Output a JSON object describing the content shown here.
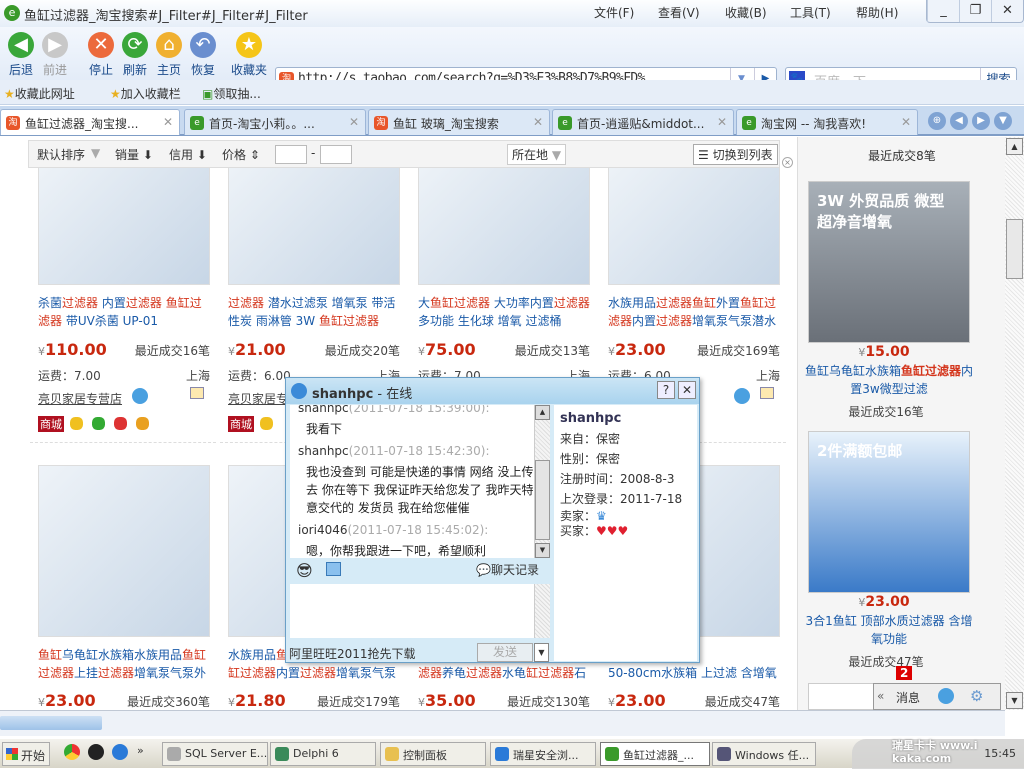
{
  "window": {
    "title": "鱼缸过滤器_淘宝搜索#J_Filter#J_Filter#J_Filter",
    "menu": [
      "文件(F)",
      "查看(V)",
      "收藏(B)",
      "工具(T)",
      "帮助(H)"
    ],
    "controls": [
      "_",
      "❐",
      "✕"
    ]
  },
  "toolbar": {
    "buttons": [
      {
        "label": "后退",
        "icon": "back-arrow-icon",
        "color": "#3aa73a",
        "glyph": "◀"
      },
      {
        "label": "前进",
        "icon": "forward-arrow-icon",
        "color": "#c8c8c8",
        "glyph": "▶"
      },
      {
        "label": "停止",
        "icon": "stop-icon",
        "color": "#ec6a3c",
        "glyph": "✕"
      },
      {
        "label": "刷新",
        "icon": "refresh-icon",
        "color": "#3aa73a",
        "glyph": "⟳"
      },
      {
        "label": "主页",
        "icon": "home-icon",
        "color": "#f0b030",
        "glyph": "⌂"
      },
      {
        "label": "恢复",
        "icon": "undo-icon",
        "color": "#6a8ecf",
        "glyph": "↶"
      },
      {
        "label": "收藏夹",
        "icon": "star-icon",
        "color": "#f5c518",
        "glyph": "★"
      }
    ],
    "url": "http://s.taobao.com/search?q=%D3%E3%B8%D7%B9%FD%",
    "search_placeholder": "百度一下",
    "search_button": "搜索"
  },
  "favbar": [
    "收藏此网址",
    "加入收藏栏",
    "领取抽..."
  ],
  "tabs": [
    {
      "label": "鱼缸过滤器_淘宝搜...",
      "active": true,
      "favicon": "淘"
    },
    {
      "label": "首页-淘宝小莉。。...",
      "favicon": "e"
    },
    {
      "label": "鱼缸 玻璃_淘宝搜索",
      "favicon": "淘"
    },
    {
      "label": "首页-逍遥贴&middot...",
      "favicon": "e"
    },
    {
      "label": "淘宝网 -- 淘我喜欢!",
      "favicon": "e"
    }
  ],
  "sortbar": {
    "default": "默认排序",
    "sales": "销量 ⬇",
    "credit": "信用 ⬇",
    "price": "价格 ⇕",
    "range_sep": "-",
    "location": "所在地",
    "switch": "☰ 切换到列表"
  },
  "products_row1": [
    {
      "title_html": "杀菌<em>过滤器</em> 内置<em>过滤器</em> <em>鱼缸过滤器</em> 带UV杀菌 UP-01",
      "price": "110.00",
      "sold": "最近成交16笔",
      "ship": "运费：7.00",
      "loc": "上海",
      "shop": "亮贝家居专营店"
    },
    {
      "title_html": "<em>过滤器</em> 潜水过滤泵 增氧泵 带活性炭 雨淋管 3W <em>鱼缸过滤器</em>",
      "price": "21.00",
      "sold": "最近成交20笔",
      "ship": "运费：6.00",
      "loc": "上海",
      "shop": "亮贝家居专"
    },
    {
      "title_html": "大<em>鱼缸过滤器</em> 大功率内置<em>过滤器</em> 多功能 生化球 增氧 过滤桶",
      "price": "75.00",
      "sold": "最近成交13笔",
      "ship": "运费：7.00",
      "loc": "上海",
      "shop": ""
    },
    {
      "title_html": "水族用品<em>过滤器鱼缸</em>外置<em>鱼缸过滤器</em>内置<em>过滤器</em>增氧泵气泵潜水",
      "price": "23.00",
      "sold": "最近成交169笔",
      "ship": "运费：6.00",
      "loc": "上海",
      "shop": "店"
    }
  ],
  "products_row2": [
    {
      "title_html": "<em>鱼缸</em>乌龟缸水族箱水族用品<em>鱼缸过滤器</em>上挂<em>过滤器</em>增氧泵气泵外",
      "price": "23.00",
      "sold": "最近成交360笔"
    },
    {
      "title_html": "水族用品<em>鱼</em><br><em>缸过滤器</em>内置<em>过滤器</em>增氧泵气泵",
      "price": "21.80",
      "sold": "最近成交179笔"
    },
    {
      "title_html": "<br><em>滤器</em>养龟<em>过滤器</em>水龟<em>缸过滤器</em>石",
      "price": "35.00",
      "sold": "最近成交130笔"
    },
    {
      "title_html": "<em>缸过滤器</em> 适用<br>50-80cm水族箱 上过滤 含增氧",
      "price": "23.00",
      "sold": "最近成交47笔"
    }
  ],
  "currency": "¥",
  "badges": {
    "mall": "商城"
  },
  "side": {
    "top_sold": "最近成交8笔",
    "items": [
      {
        "price": "15.00",
        "title_html": "鱼缸乌龟缸水族箱<b style=\"color:#d4351c\">鱼缸过滤器</b>内置3w微型过滤",
        "sold": "最近成交16笔",
        "img_text": "3W 外贸品质 微型 超净音增氧"
      },
      {
        "price": "23.00",
        "title_html": "3合1鱼缸 顶部水质过滤器 含增氧功能",
        "sold": "最近成交47笔",
        "img_text": "2件满额包邮"
      }
    ]
  },
  "wangwang_bar": {
    "count": "2",
    "label": "消息",
    "collapse": "«"
  },
  "chat": {
    "title_user": "shanhpc",
    "title_status": " - 在线",
    "help": "?",
    "close": "✕",
    "messages": [
      {
        "who": "shanhpc",
        "time": "(2011-07-18 15:39:00):",
        "text": "我看下"
      },
      {
        "who": "shanhpc",
        "time": "(2011-07-18 15:42:30):",
        "text": "我也没查到 可能是快递的事情 网络 没上传去 你在等下 我保证昨天给您发了 我昨天特意交代的 发货员 我在给您催催"
      },
      {
        "who": "iori4046",
        "time": "(2011-07-18 15:45:02):",
        "text": "嗯，你帮我跟进一下吧，希望顺利"
      }
    ],
    "history": "聊天记录",
    "ad": "阿里旺旺2011抢先下载",
    "send": "发送",
    "info": {
      "name": "shanhpc",
      "from": "来自：保密",
      "gender": "性别：保密",
      "reg": "注册时间：2008-8-3",
      "last": "上次登录：2011-7-18",
      "seller": "卖家：",
      "buyer": "买家："
    }
  },
  "taskbar": {
    "start": "开始",
    "tasks": [
      {
        "label": "SQL Server E..."
      },
      {
        "label": "Delphi 6"
      },
      {
        "label": "控制面板"
      },
      {
        "label": "瑞星安全浏..."
      },
      {
        "label": "鱼缸过滤器_...",
        "active": true
      },
      {
        "label": "Windows 任..."
      }
    ],
    "clock": "15:45",
    "watermark": "瑞星卡卡 www.ikaka.com"
  }
}
